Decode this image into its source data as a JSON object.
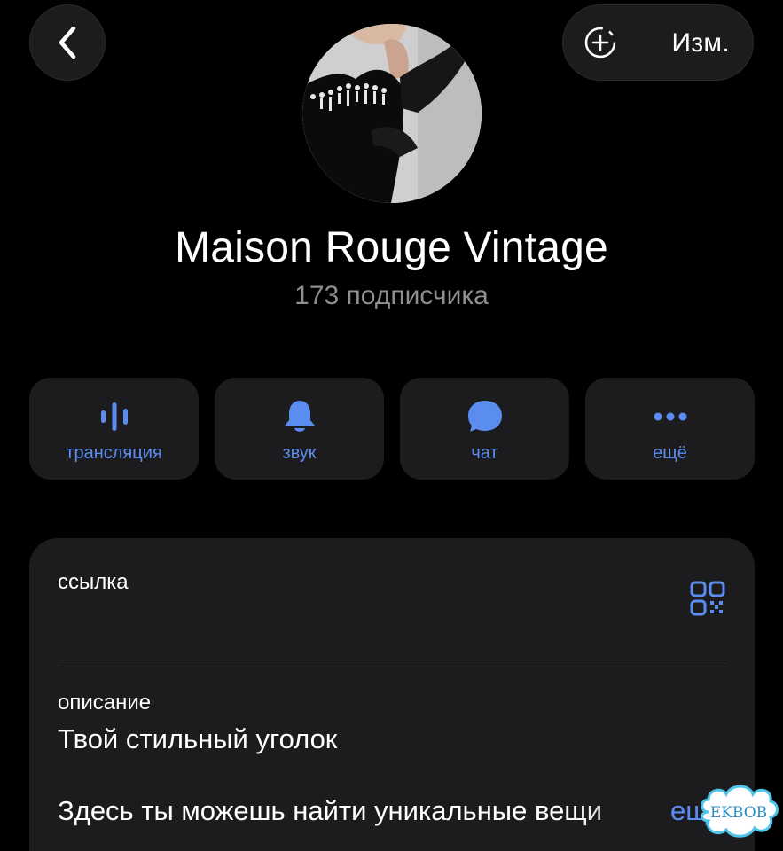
{
  "header": {
    "back_icon": "chevron-left-icon",
    "add_icon": "add-story-icon",
    "edit_label": "Изм."
  },
  "profile": {
    "name": "Maison Rouge Vintage",
    "subscribers": "173 подписчика"
  },
  "actions": [
    {
      "label": "трансляция",
      "icon": "live-stream-icon"
    },
    {
      "label": "звук",
      "icon": "bell-icon"
    },
    {
      "label": "чат",
      "icon": "chat-bubble-icon"
    },
    {
      "label": "ещё",
      "icon": "more-dots-icon"
    }
  ],
  "info": {
    "link_label": "ссылка",
    "description_label": "описание",
    "description_line1": "Твой стильный уголок",
    "description_line2": "Здесь ты можешь найти уникальные вещи",
    "more_label": "ещё"
  },
  "watermark": "EKBOB",
  "colors": {
    "accent": "#5b8df0",
    "background": "#000000",
    "surface": "#1c1c1e",
    "secondary_text": "#8e8e93"
  }
}
